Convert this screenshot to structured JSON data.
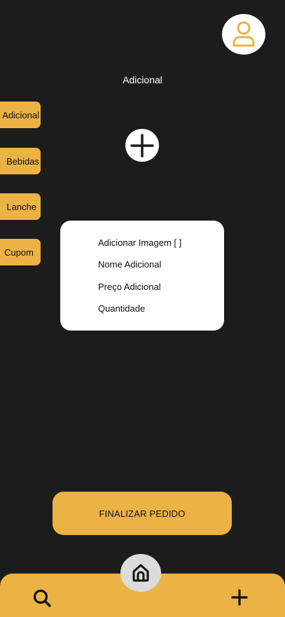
{
  "colors": {
    "background": "#1c1c1c",
    "accent": "#ebb244",
    "surface": "#ffffff",
    "home_button": "#dcdcdc",
    "text_dark": "#111111"
  },
  "header": {
    "avatar_icon": "user-icon",
    "title": "Adicional"
  },
  "categories": [
    {
      "label": "Adicional"
    },
    {
      "label": "Bebidas"
    },
    {
      "label": "Lanche"
    },
    {
      "label": "Cupom"
    }
  ],
  "add_button_icon": "plus-icon",
  "form": {
    "fields": [
      {
        "label": "Adicionar Imagem [ ]"
      },
      {
        "label": "Nome Adicional"
      },
      {
        "label": "Preço Adicional"
      },
      {
        "label": "Quantidade"
      }
    ]
  },
  "finalize_label": "FINALIZAR PEDIDO",
  "bottom_nav": {
    "home_icon": "home-icon",
    "search_icon": "search-icon",
    "add_icon": "plus-icon"
  }
}
